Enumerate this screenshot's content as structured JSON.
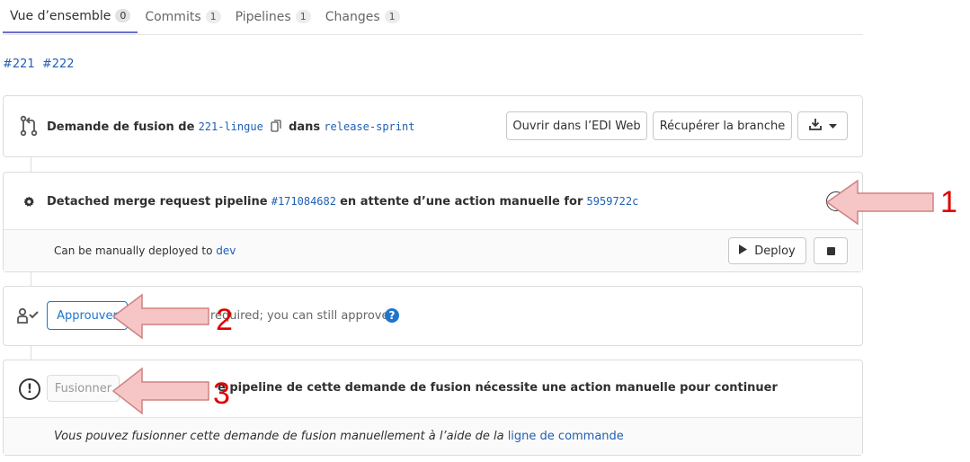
{
  "tabs": [
    {
      "label": "Vue d’ensemble",
      "count": "0"
    },
    {
      "label": "Commits",
      "count": "1"
    },
    {
      "label": "Pipelines",
      "count": "1"
    },
    {
      "label": "Changes",
      "count": "1"
    }
  ],
  "refs": {
    "first": "#221",
    "second": "#222"
  },
  "merge_header": {
    "prefix": "Demande de fusion de",
    "source_branch": "221-lingue",
    "in_label": "dans",
    "target_branch": "release-sprint",
    "open_ide_label": "Ouvrir dans l’EDI Web",
    "checkout_label": "Récupérer la branche"
  },
  "pipeline": {
    "prefix": "Detached merge request pipeline",
    "pipeline_id": "#171084682",
    "status_text": "en attente d’une action manuelle for",
    "commit_sha": "5959722c",
    "deploy_prefix": "Can be manually deployed to",
    "environment": "dev",
    "deploy_label": "Deploy"
  },
  "approval": {
    "button_label": "Approuver",
    "text": "required; you can still approve"
  },
  "merge": {
    "button_label": "Fusionner",
    "status_text": "e pipeline de cette demande de fusion nécessite une action manuelle pour continuer",
    "manual_text": "Vous pouvez fusionner cette demande de fusion manuellement à l’aide de la",
    "manual_link": "ligne de commande"
  },
  "annotations": {
    "one": "1",
    "two": "2",
    "three": "3",
    "color": "#e00000",
    "arrow_fill": "#f6c6c6"
  },
  "colors": {
    "link": "#1f5fb4",
    "tab_active": "#6b6fc8",
    "help": "#1f75cb"
  }
}
